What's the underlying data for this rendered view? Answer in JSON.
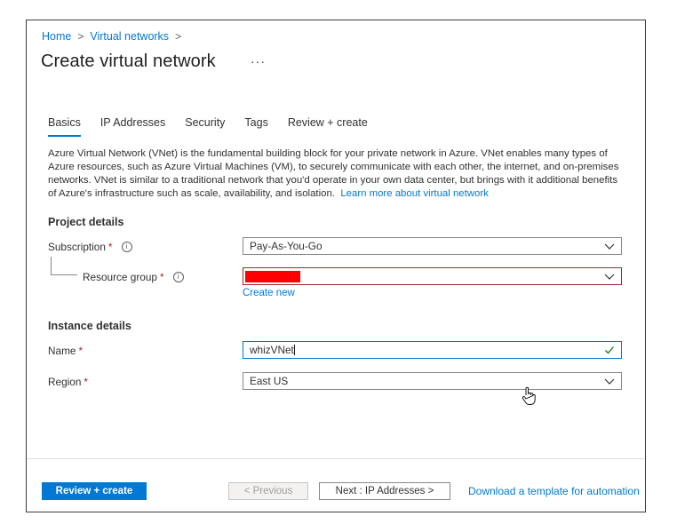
{
  "breadcrumb": {
    "home": "Home",
    "sep1": ">",
    "virtual_networks": "Virtual networks",
    "sep2": ">"
  },
  "page": {
    "title": "Create virtual network",
    "more": "···"
  },
  "tabs": [
    {
      "label": "Basics",
      "active": true
    },
    {
      "label": "IP Addresses"
    },
    {
      "label": "Security"
    },
    {
      "label": "Tags"
    },
    {
      "label": "Review + create"
    }
  ],
  "description": {
    "text": "Azure Virtual Network (VNet) is the fundamental building block for your private network in Azure. VNet enables many types of Azure resources, such as Azure Virtual Machines (VM), to securely communicate with each other, the internet, and on-premises networks. VNet is similar to a traditional network that you'd operate in your own data center, but brings with it additional benefits of Azure's infrastructure such as scale, availability, and isolation.",
    "learn_more": "Learn more about virtual network"
  },
  "project_details": {
    "heading": "Project details",
    "subscription_label": "Subscription",
    "subscription_value": "Pay-As-You-Go",
    "resource_group_label": "Resource group",
    "create_new": "Create new"
  },
  "instance_details": {
    "heading": "Instance details",
    "name_label": "Name",
    "name_value": "whizVNet",
    "region_label": "Region",
    "region_value": "East US"
  },
  "required_marker": "*",
  "info_symbol": "i",
  "footer": {
    "review_create": "Review + create",
    "previous": "< Previous",
    "next": "Next : IP Addresses >",
    "download": "Download a template for automation"
  },
  "icons": {
    "chevron": "chevron-down-icon",
    "check": "checkmark-icon",
    "info": "info-icon",
    "cursor": "hand-cursor-icon"
  },
  "colors": {
    "accent": "#0078d4",
    "required": "#a4262c",
    "redacted": "#ff0000",
    "valid": "#107c10"
  }
}
